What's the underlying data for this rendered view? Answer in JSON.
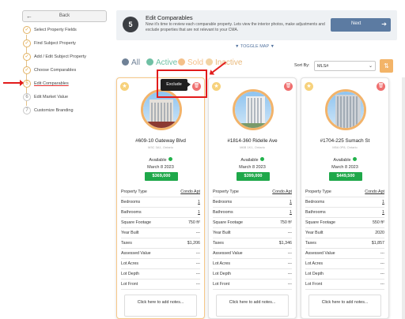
{
  "sidebar": {
    "back_label": "Back",
    "steps": [
      {
        "num": "✓",
        "label": "Select Property Fields"
      },
      {
        "num": "✓",
        "label": "Find Subject Property"
      },
      {
        "num": "✓",
        "label": "Add / Edit Subject Property"
      },
      {
        "num": "✓",
        "label": "Choose Comparables"
      },
      {
        "num": "5",
        "label": "Edit Comparables"
      },
      {
        "num": "6",
        "label": "Edit Market Value"
      },
      {
        "num": "7",
        "label": "Customize Branding"
      }
    ]
  },
  "header": {
    "step": "5",
    "title": "Edit Comparables",
    "description": "Now it's time to review each comparable property. Lets view the interior photos, make adjustments and exclude properties that are not relevant to your CMA.",
    "next_label": "Next"
  },
  "toggle_map": "▼ TOGGLE MAP ▼",
  "filters": [
    {
      "label": "All",
      "color": "#6f8196"
    },
    {
      "label": "Active",
      "color": "#6fc0a4"
    },
    {
      "label": "Sold",
      "color": "#f4c08a"
    },
    {
      "label": "Inactive",
      "color": "#f2d3a3"
    }
  ],
  "sort": {
    "label": "Sort By:",
    "value": "MLS#"
  },
  "tooltip": "Exclude",
  "row_labels": [
    "Property Type",
    "Bedrooms",
    "Bathrooms",
    "Square Footage",
    "Year Built",
    "Taxes",
    "Assessed Value",
    "Lot Acres",
    "Lot Depth",
    "Lot Front"
  ],
  "notes_label": "Click here to add notes...",
  "cards": [
    {
      "address": "#609-10 Gateway Blvd",
      "sub": "M3C 3A1, Ontario",
      "status": "Available",
      "date": "March 8 2023",
      "price": "$369,000",
      "values": [
        "Condo Apt",
        "1",
        "1",
        "750 ft²",
        "---",
        "$1,206",
        "---",
        "---",
        "---",
        "---"
      ]
    },
    {
      "address": "#1814-360 Ridelle Ave",
      "sub": "M6B 1K1, Ontario",
      "status": "Available",
      "date": "March 8 2023",
      "price": "$399,000",
      "values": [
        "Condo Apt",
        "1",
        "1",
        "750 ft²",
        "---",
        "$1,346",
        "---",
        "---",
        "---",
        "---"
      ]
    },
    {
      "address": "#1704-225 Sumach St",
      "sub": "M5A 0P8, Ontario",
      "status": "Available",
      "date": "March 8 2023",
      "price": "$449,500",
      "values": [
        "Condo Apt",
        "1",
        "1",
        "550 ft²",
        "2020",
        "$1,857",
        "---",
        "---",
        "---",
        "---"
      ]
    }
  ]
}
